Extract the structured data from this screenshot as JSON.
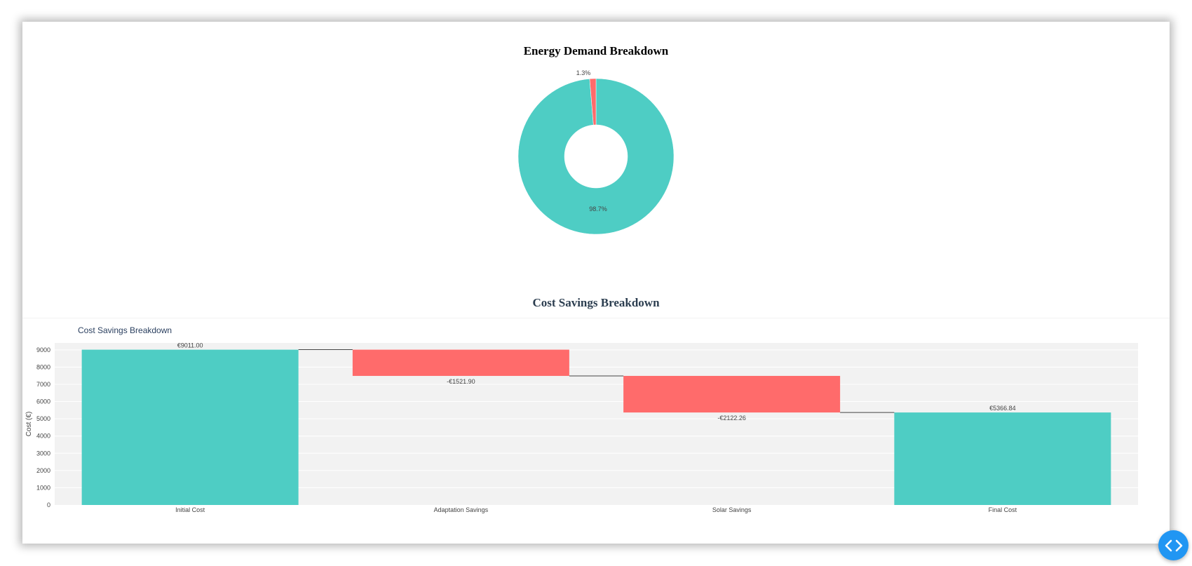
{
  "pie_section_title": "Energy Demand Breakdown",
  "waterfall_section_title": "Cost Savings Breakdown",
  "chart_data": [
    {
      "type": "pie",
      "hole": true,
      "slices": [
        {
          "share": 98.7,
          "label": "98.7%",
          "color": "#4ecdc4"
        },
        {
          "share": 1.3,
          "label": "1.3%",
          "color": "#ff6b6b"
        }
      ]
    },
    {
      "type": "waterfall",
      "title": "Cost Savings Breakdown",
      "ylabel": "Cost (€)",
      "ylim": [
        0,
        9400
      ],
      "yticks": [
        0,
        1000,
        2000,
        3000,
        4000,
        5000,
        6000,
        7000,
        8000,
        9000
      ],
      "grid": true,
      "categories": [
        "Initial Cost",
        "Adaptation Savings",
        "Solar Savings",
        "Final Cost"
      ],
      "measures": [
        "absolute",
        "relative",
        "relative",
        "total"
      ],
      "values": [
        9011.0,
        -1521.9,
        -2122.26,
        5366.84
      ],
      "text": [
        "€9011.00",
        "-€1521.90",
        "-€2122.26",
        "€5366.84"
      ],
      "colors": {
        "total": "#4ecdc4",
        "decrease": "#ff6b6b",
        "connector": "#444444",
        "plot_bg": "#f2f2f2"
      }
    }
  ],
  "toolbar": {
    "code_icon": "code-brackets-icon"
  }
}
